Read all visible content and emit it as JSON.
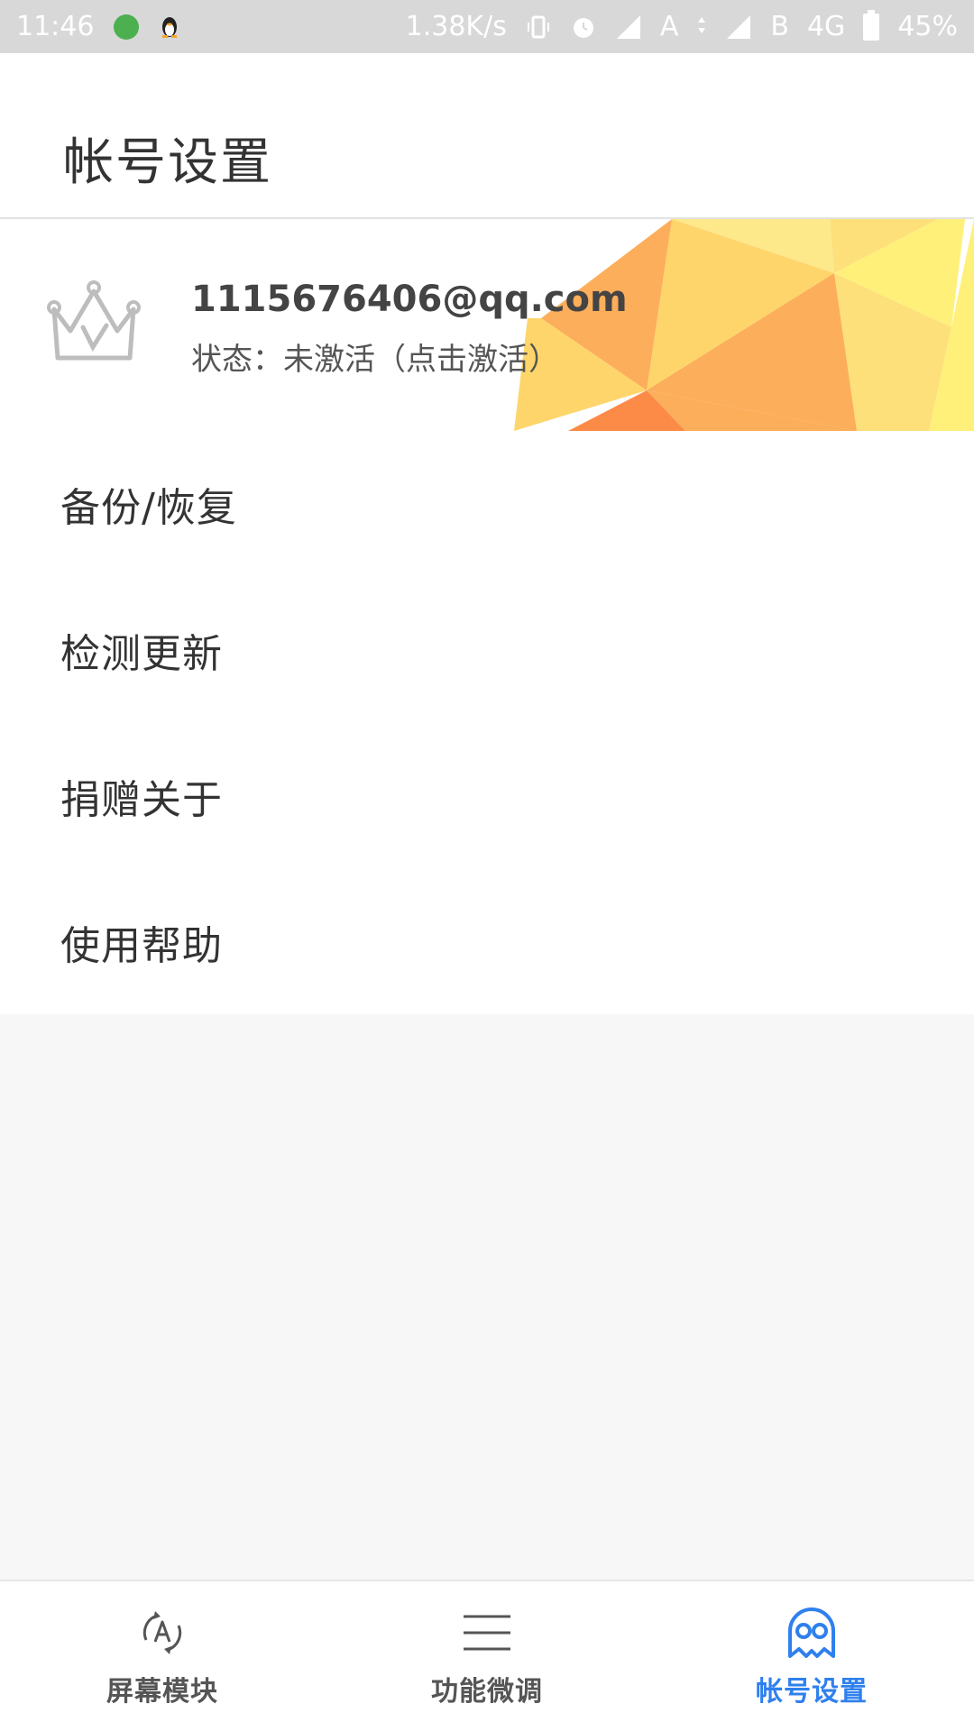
{
  "status_bar": {
    "time": "11:46",
    "net_speed": "1.38K/s",
    "sim_a": "A",
    "sim_b": "B",
    "network": "4G",
    "battery": "45%",
    "icons": [
      "app-green-icon",
      "qq-penguin-icon",
      "vibrate-icon",
      "alarm-icon",
      "signal-icon",
      "data-arrows-icon",
      "signal-icon",
      "battery-icon"
    ]
  },
  "header": {
    "title": "帐号设置"
  },
  "account": {
    "email": "1115676406@qq.com",
    "status": "状态：未激活（点击激活）",
    "icon": "crown-v-icon"
  },
  "menu": {
    "items": [
      {
        "label": "备份/恢复"
      },
      {
        "label": "检测更新"
      },
      {
        "label": "捐赠关于"
      },
      {
        "label": "使用帮助"
      }
    ]
  },
  "bottom_nav": {
    "items": [
      {
        "label": "屏幕模块",
        "icon": "auto-rotate-icon",
        "active": false
      },
      {
        "label": "功能微调",
        "icon": "menu-lines-icon",
        "active": false
      },
      {
        "label": "帐号设置",
        "icon": "ghost-icon",
        "active": true
      }
    ],
    "active_color": "#2f80ed"
  }
}
